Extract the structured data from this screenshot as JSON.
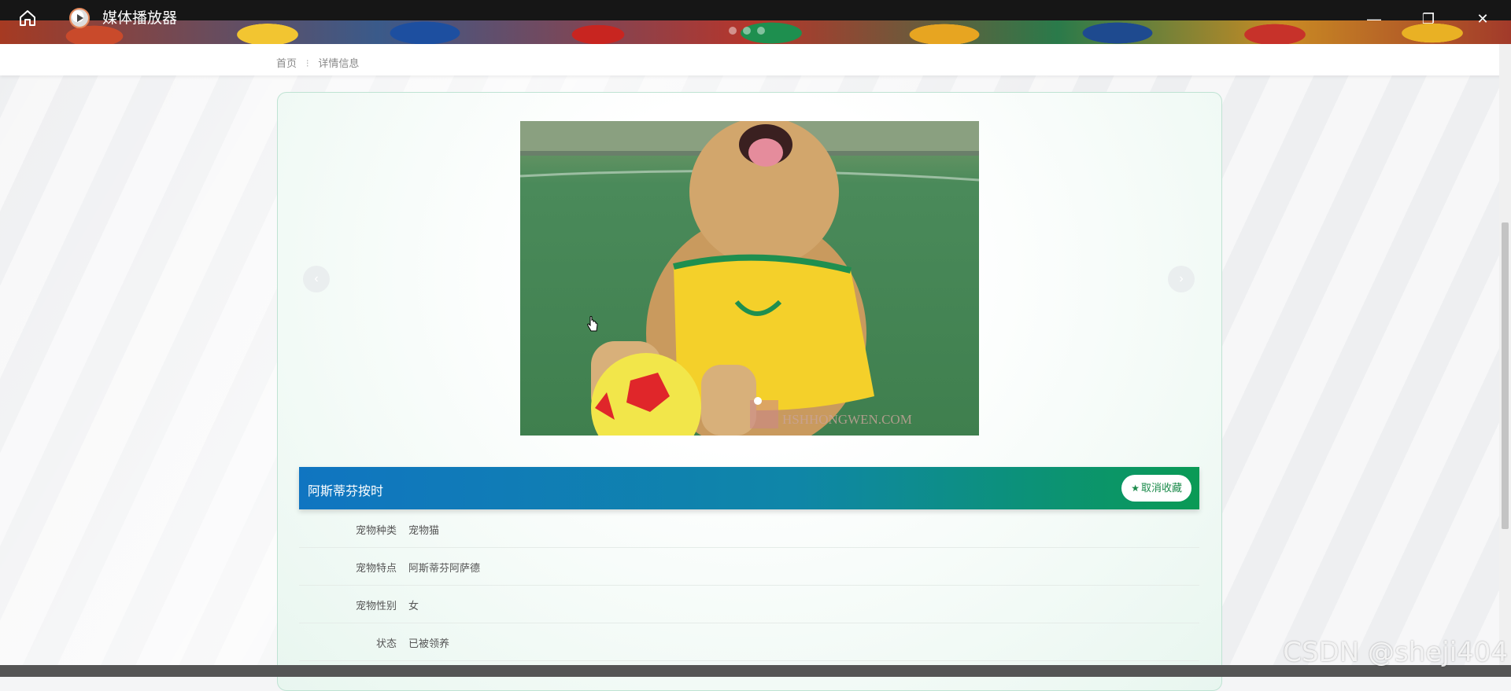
{
  "titlebar": {
    "app_title": "媒体播放器",
    "minimize": "—",
    "maximize": "❐",
    "close": "✕"
  },
  "breadcrumb": {
    "home": "首页",
    "separator": "⁝",
    "current": "详情信息"
  },
  "carousel": {
    "prev": "‹",
    "next": "›",
    "photo_caption": "HSHHONGWEN.COM"
  },
  "pet": {
    "name": "阿斯蒂芬按时",
    "favorite_label": "取消收藏",
    "favorite_icon": "star-icon"
  },
  "details": [
    {
      "label": "宠物种类",
      "value": "宠物猫"
    },
    {
      "label": "宠物特点",
      "value": "阿斯蒂芬阿萨德"
    },
    {
      "label": "宠物性别",
      "value": "女"
    },
    {
      "label": "状态",
      "value": "已被领养"
    }
  ],
  "watermark": "CSDN @sheji404",
  "colors": {
    "title_band_start": "#1075c1",
    "title_band_end": "#0a9a55",
    "card_border": "#bfe3d3"
  }
}
